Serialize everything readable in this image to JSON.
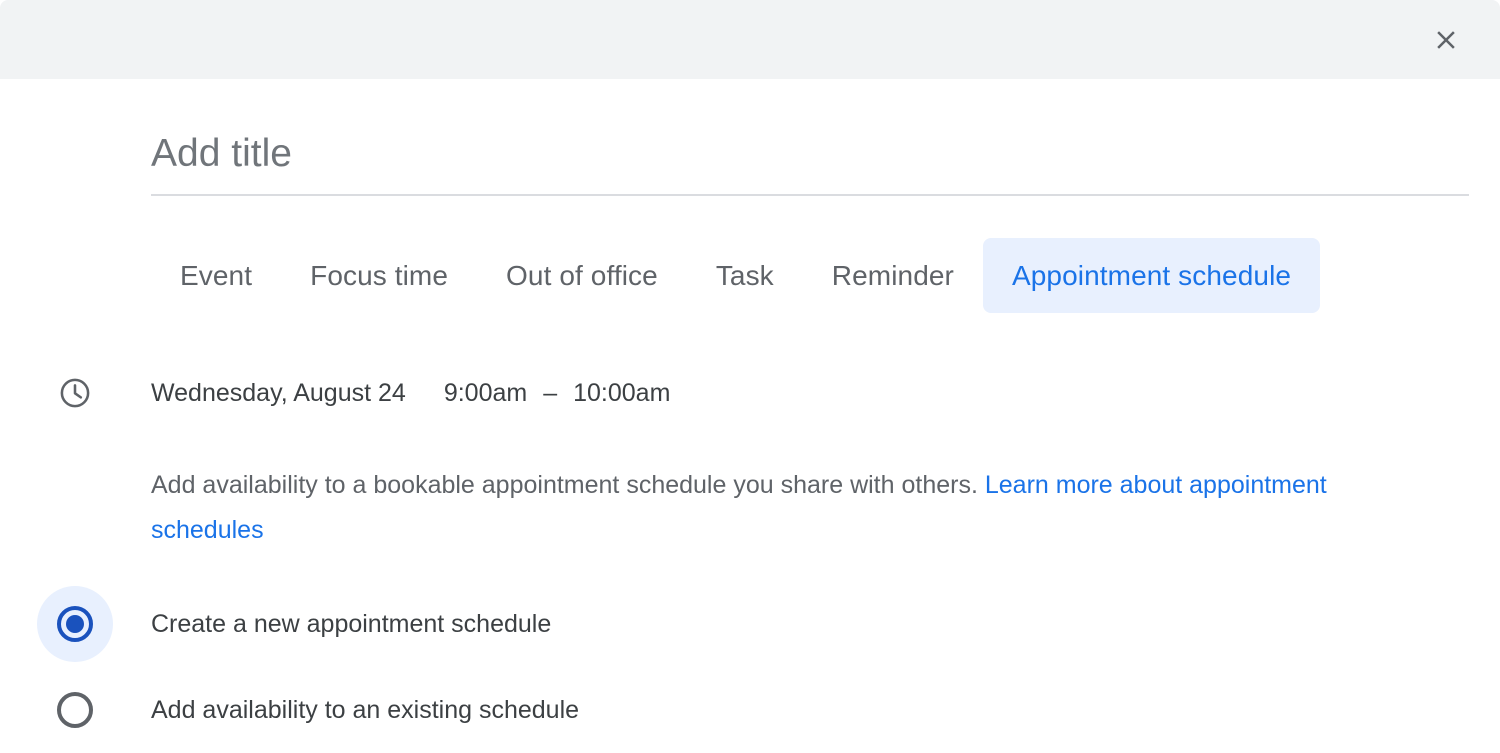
{
  "header": {
    "close_icon": "close-icon",
    "background_color": "#f1f3f4"
  },
  "title_field": {
    "value": "",
    "placeholder": "Add title"
  },
  "tabs": [
    {
      "label": "Event",
      "active": false
    },
    {
      "label": "Focus time",
      "active": false
    },
    {
      "label": "Out of office",
      "active": false
    },
    {
      "label": "Task",
      "active": false
    },
    {
      "label": "Reminder",
      "active": false
    },
    {
      "label": "Appointment schedule",
      "active": true
    }
  ],
  "schedule": {
    "icon": "clock-icon",
    "date": "Wednesday, August 24",
    "start_time": "9:00am",
    "dash": "–",
    "end_time": "10:00am"
  },
  "description": {
    "text": "Add availability to a bookable appointment schedule you share with others. ",
    "link_text": "Learn more about appointment schedules"
  },
  "options": [
    {
      "label": "Create a new appointment schedule",
      "selected": true
    },
    {
      "label": "Add availability to an existing schedule",
      "selected": false
    }
  ],
  "colors": {
    "accent_blue": "#1a73e8",
    "active_tab_bg": "#e8f0fe",
    "radio_selected": "#1a52bd",
    "text_primary": "#3c4043",
    "text_secondary": "#5f6368"
  }
}
